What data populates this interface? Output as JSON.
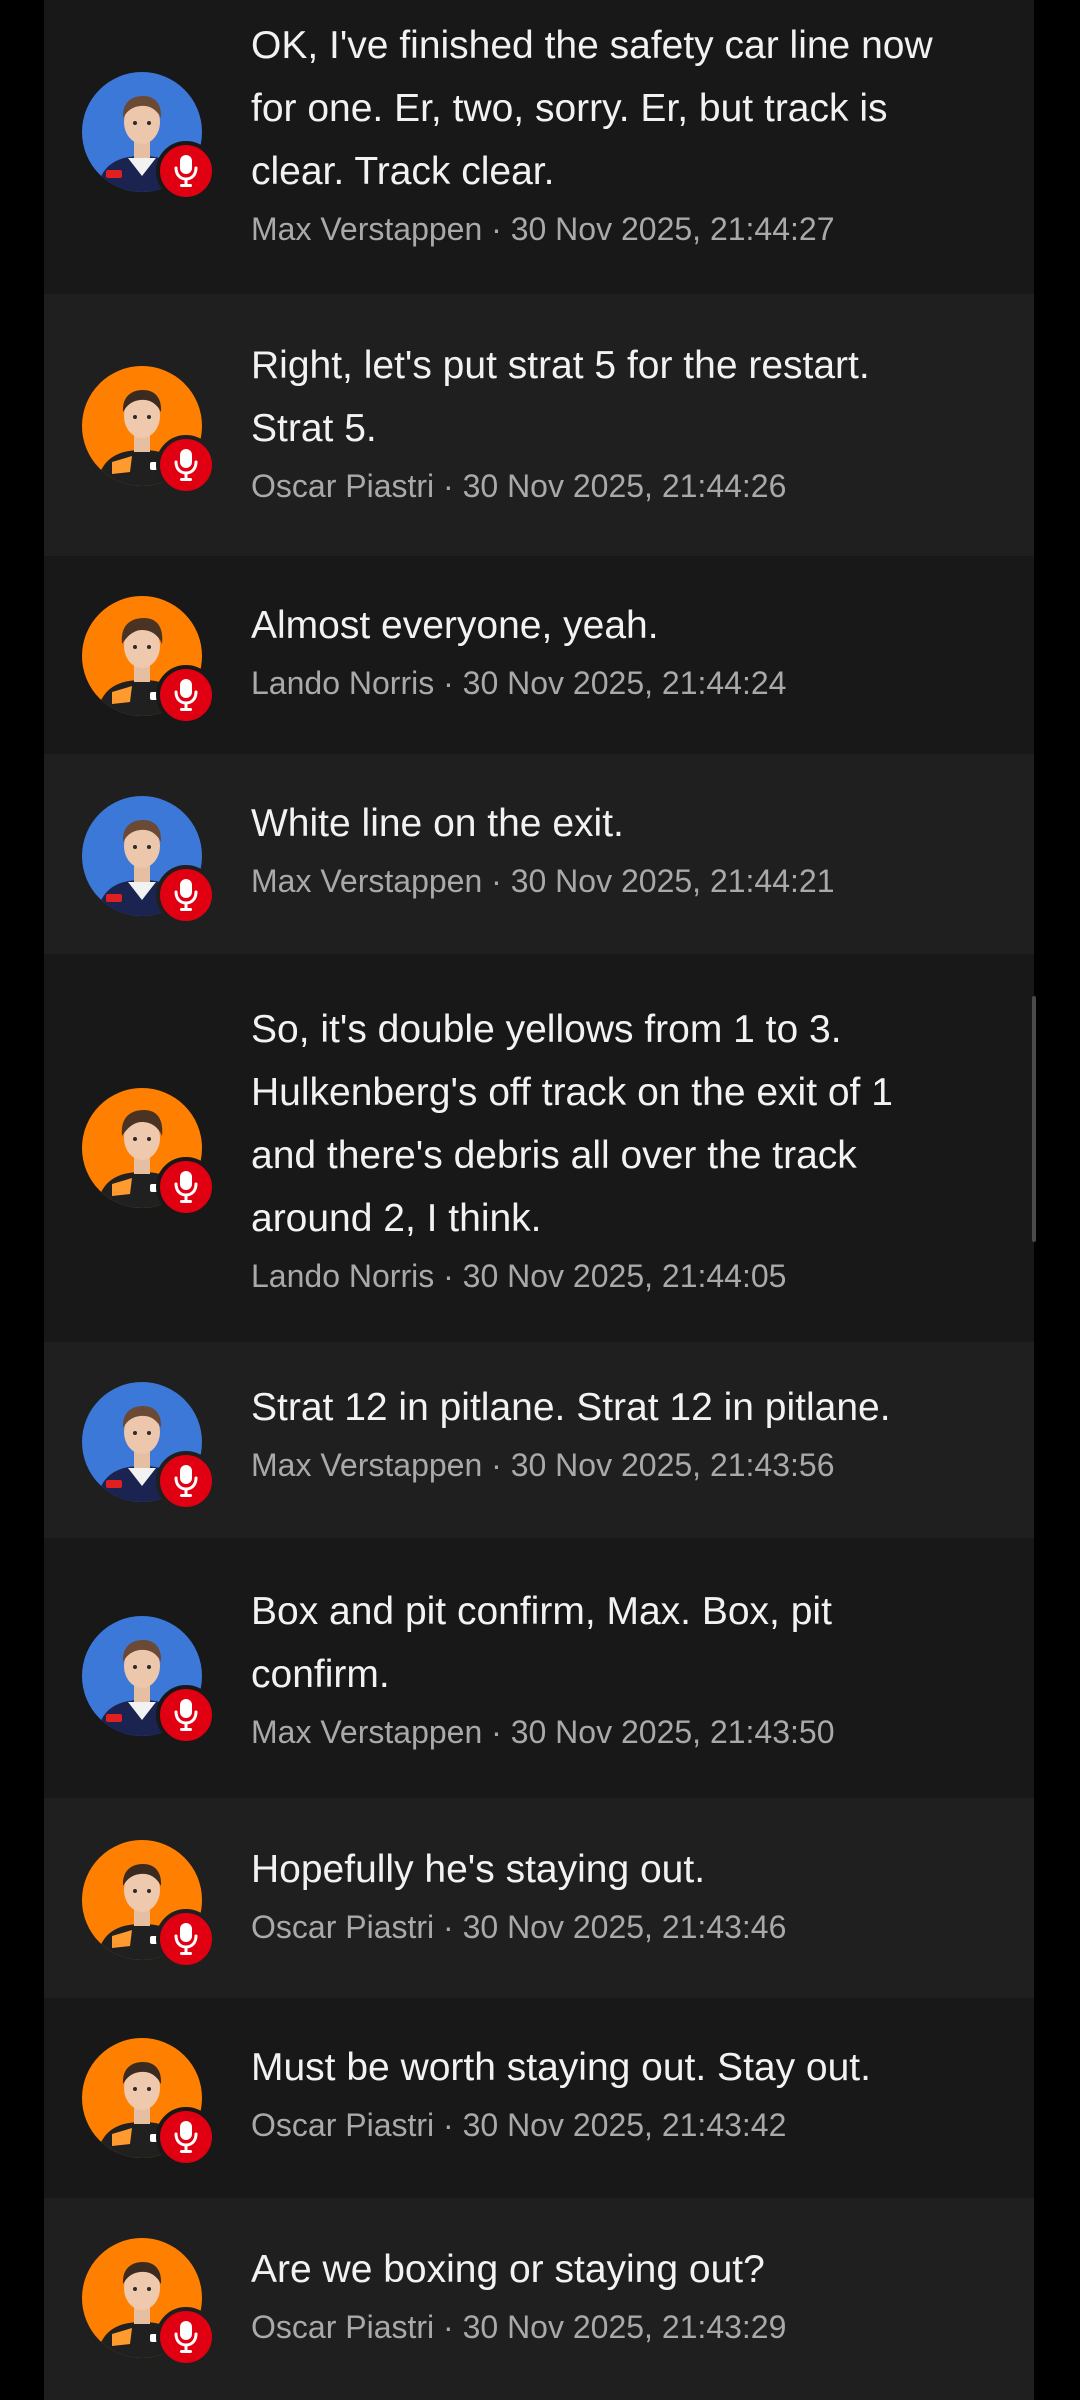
{
  "colors": {
    "page_background": "#000000",
    "message_dark": "#181818",
    "message_light": "#1f1f1f",
    "text_primary": "#f2f2f2",
    "text_meta": "#a9a9a9",
    "mic_badge": "#e00012",
    "red_bull_avatar_bg": "#3b78d8",
    "mclaren_avatar_bg": "#ff8000"
  },
  "icons": {
    "mic_badge": "microphone-icon"
  },
  "messages": [
    {
      "text": "OK, I've finished the safety car line now\nfor one. Er, two, sorry. Er, but track is\nclear. Track clear.",
      "author": "Max Verstappen",
      "timestamp": "30 Nov 2025, 21:44:27",
      "meta": "Max Verstappen · 30 Nov 2025, 21:44:27",
      "team": "red-bull"
    },
    {
      "text": "Right, let's put strat 5 for the restart.\nStrat 5.",
      "author": "Oscar Piastri",
      "timestamp": "30 Nov 2025, 21:44:26",
      "meta": "Oscar Piastri · 30 Nov 2025, 21:44:26",
      "team": "mclaren"
    },
    {
      "text": "Almost everyone, yeah.",
      "author": "Lando Norris",
      "timestamp": "30 Nov 2025, 21:44:24",
      "meta": "Lando Norris · 30 Nov 2025, 21:44:24",
      "team": "mclaren"
    },
    {
      "text": "White line on the exit.",
      "author": "Max Verstappen",
      "timestamp": "30 Nov 2025, 21:44:21",
      "meta": "Max Verstappen · 30 Nov 2025, 21:44:21",
      "team": "red-bull"
    },
    {
      "text": "So, it's double yellows from 1 to 3.\nHulkenberg's off track on the exit of 1\nand there's debris all over the track\naround 2, I think.",
      "author": "Lando Norris",
      "timestamp": "30 Nov 2025, 21:44:05",
      "meta": "Lando Norris · 30 Nov 2025, 21:44:05",
      "team": "mclaren"
    },
    {
      "text": "Strat 12 in pitlane. Strat 12 in pitlane.",
      "author": "Max Verstappen",
      "timestamp": "30 Nov 2025, 21:43:56",
      "meta": "Max Verstappen · 30 Nov 2025, 21:43:56",
      "team": "red-bull"
    },
    {
      "text": "Box and pit confirm, Max. Box, pit\nconfirm.",
      "author": "Max Verstappen",
      "timestamp": "30 Nov 2025, 21:43:50",
      "meta": "Max Verstappen · 30 Nov 2025, 21:43:50",
      "team": "red-bull"
    },
    {
      "text": "Hopefully he's staying out.",
      "author": "Oscar Piastri",
      "timestamp": "30 Nov 2025, 21:43:46",
      "meta": "Oscar Piastri · 30 Nov 2025, 21:43:46",
      "team": "mclaren"
    },
    {
      "text": "Must be worth staying out. Stay out.",
      "author": "Oscar Piastri",
      "timestamp": "30 Nov 2025, 21:43:42",
      "meta": "Oscar Piastri · 30 Nov 2025, 21:43:42",
      "team": "mclaren"
    },
    {
      "text": "Are we boxing or staying out?",
      "author": "Oscar Piastri",
      "timestamp": "30 Nov 2025, 21:43:29",
      "meta": "Oscar Piastri · 30 Nov 2025, 21:43:29",
      "team": "mclaren"
    }
  ]
}
